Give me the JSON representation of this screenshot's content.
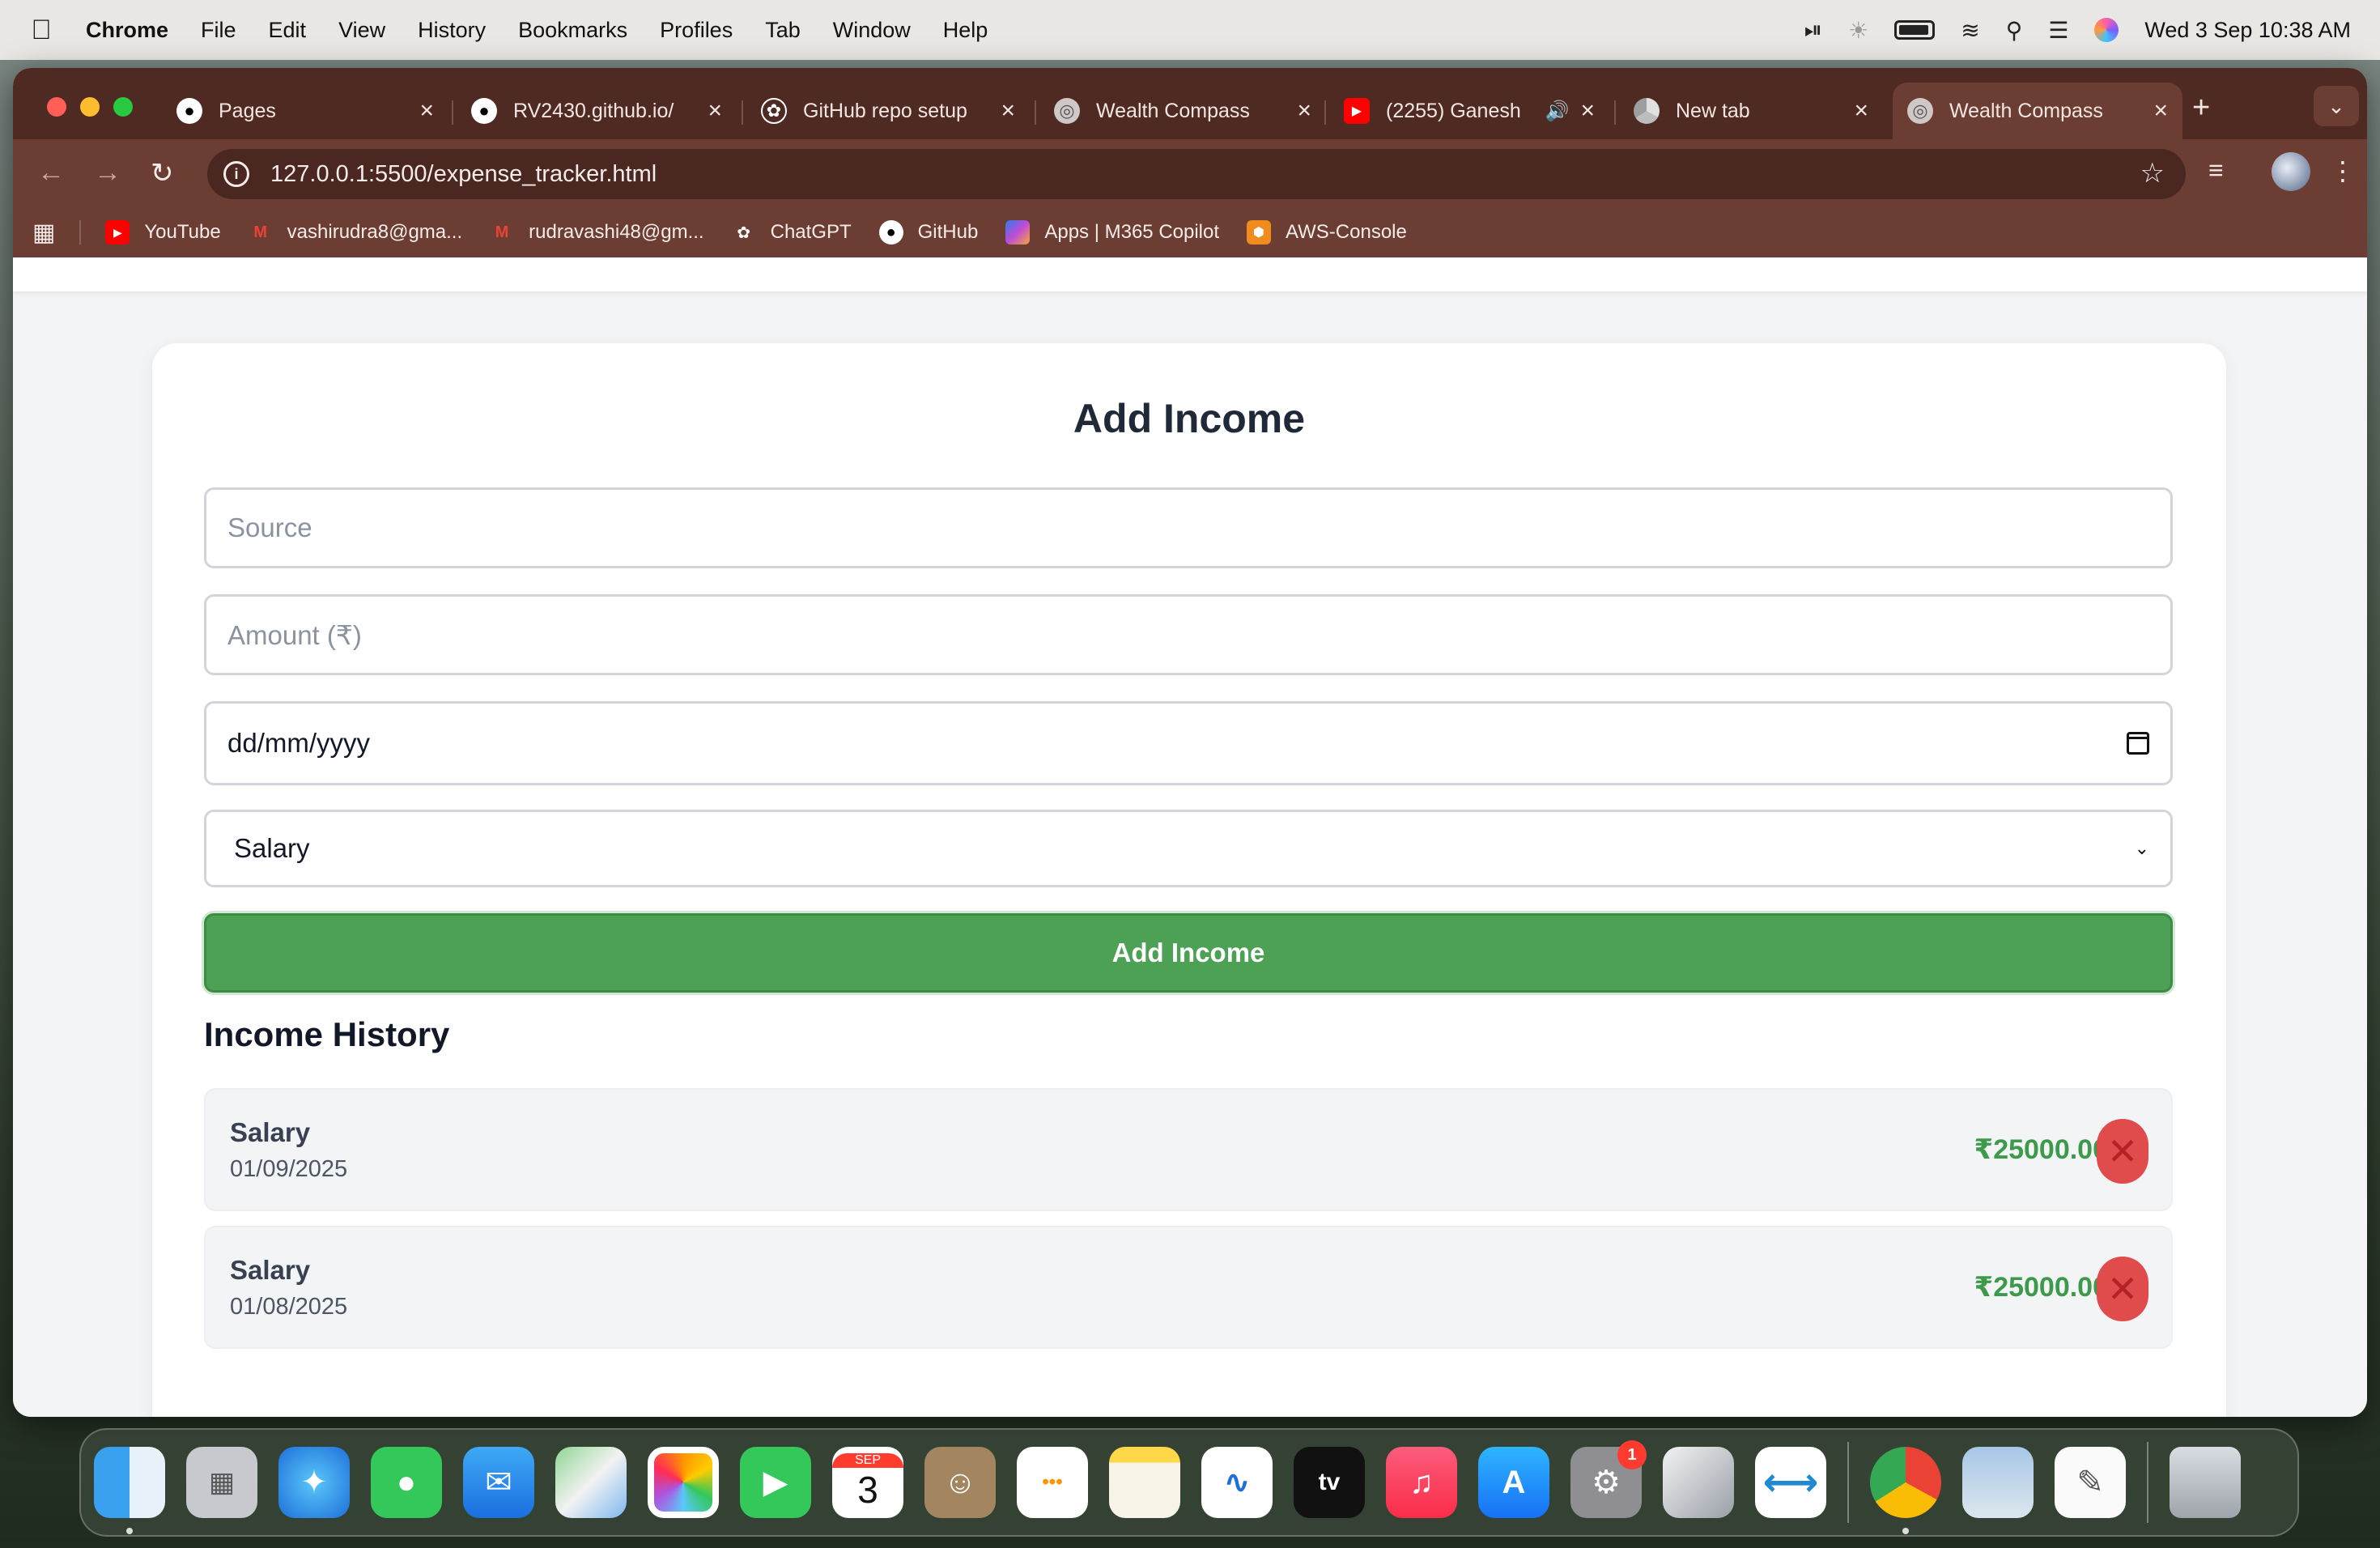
{
  "menubar": {
    "app_name": "Chrome",
    "items": [
      "File",
      "Edit",
      "View",
      "History",
      "Bookmarks",
      "Profiles",
      "Tab",
      "Window",
      "Help"
    ],
    "datetime": "Wed 3 Sep  10:38 AM"
  },
  "tabs": [
    {
      "label": "Pages",
      "icon": "github-icon"
    },
    {
      "label": "RV2430.github.io/",
      "icon": "github-icon"
    },
    {
      "label": "GitHub repo setup",
      "icon": "chatgpt-icon"
    },
    {
      "label": "Wealth Compass",
      "icon": "globe-icon"
    },
    {
      "label": "(2255) Ganesh",
      "icon": "youtube-icon"
    },
    {
      "label": "New tab",
      "icon": "chrome-icon"
    },
    {
      "label": "Wealth Compass",
      "icon": "globe-icon",
      "active": true
    }
  ],
  "address_bar": {
    "url": "127.0.0.1:5500/expense_tracker.html"
  },
  "bookmarks": [
    {
      "label": "YouTube",
      "icon": "youtube-icon"
    },
    {
      "label": "vashirudra8@gma...",
      "icon": "gmail-icon"
    },
    {
      "label": "rudravashi48@gm...",
      "icon": "gmail-icon"
    },
    {
      "label": "ChatGPT",
      "icon": "chatgpt-icon"
    },
    {
      "label": "GitHub",
      "icon": "github-icon"
    },
    {
      "label": "Apps | M365 Copilot",
      "icon": "copilot-icon"
    },
    {
      "label": "AWS-Console",
      "icon": "aws-icon"
    }
  ],
  "form": {
    "title": "Add Income",
    "source_placeholder": "Source",
    "amount_placeholder": "Amount (₹)",
    "date_placeholder": "dd/mm/yyyy",
    "category_value": "Salary",
    "submit_label": "Add Income"
  },
  "history": {
    "title": "Income History",
    "items": [
      {
        "source": "Salary",
        "date": "01/09/2025",
        "amount": "₹25000.00"
      },
      {
        "source": "Salary",
        "date": "01/08/2025",
        "amount": "₹25000.00"
      }
    ]
  },
  "dock": {
    "calendar_month": "SEP",
    "calendar_day": "3",
    "settings_badge": "1",
    "apps": [
      "finder",
      "launchpad",
      "safari",
      "messages",
      "mail",
      "maps",
      "photos",
      "facetime",
      "calendar",
      "contacts",
      "reminders",
      "notes",
      "freeform",
      "tv",
      "music",
      "app-store",
      "system-settings",
      "iphone-mirroring",
      "vscode",
      "chrome",
      "preview",
      "textedit",
      "trash"
    ]
  },
  "colors": {
    "accent_green": "#4ca154",
    "amount_green": "#3d9a4a",
    "delete_red": "#e04b4b",
    "browser_frame": "#6c3d32"
  }
}
